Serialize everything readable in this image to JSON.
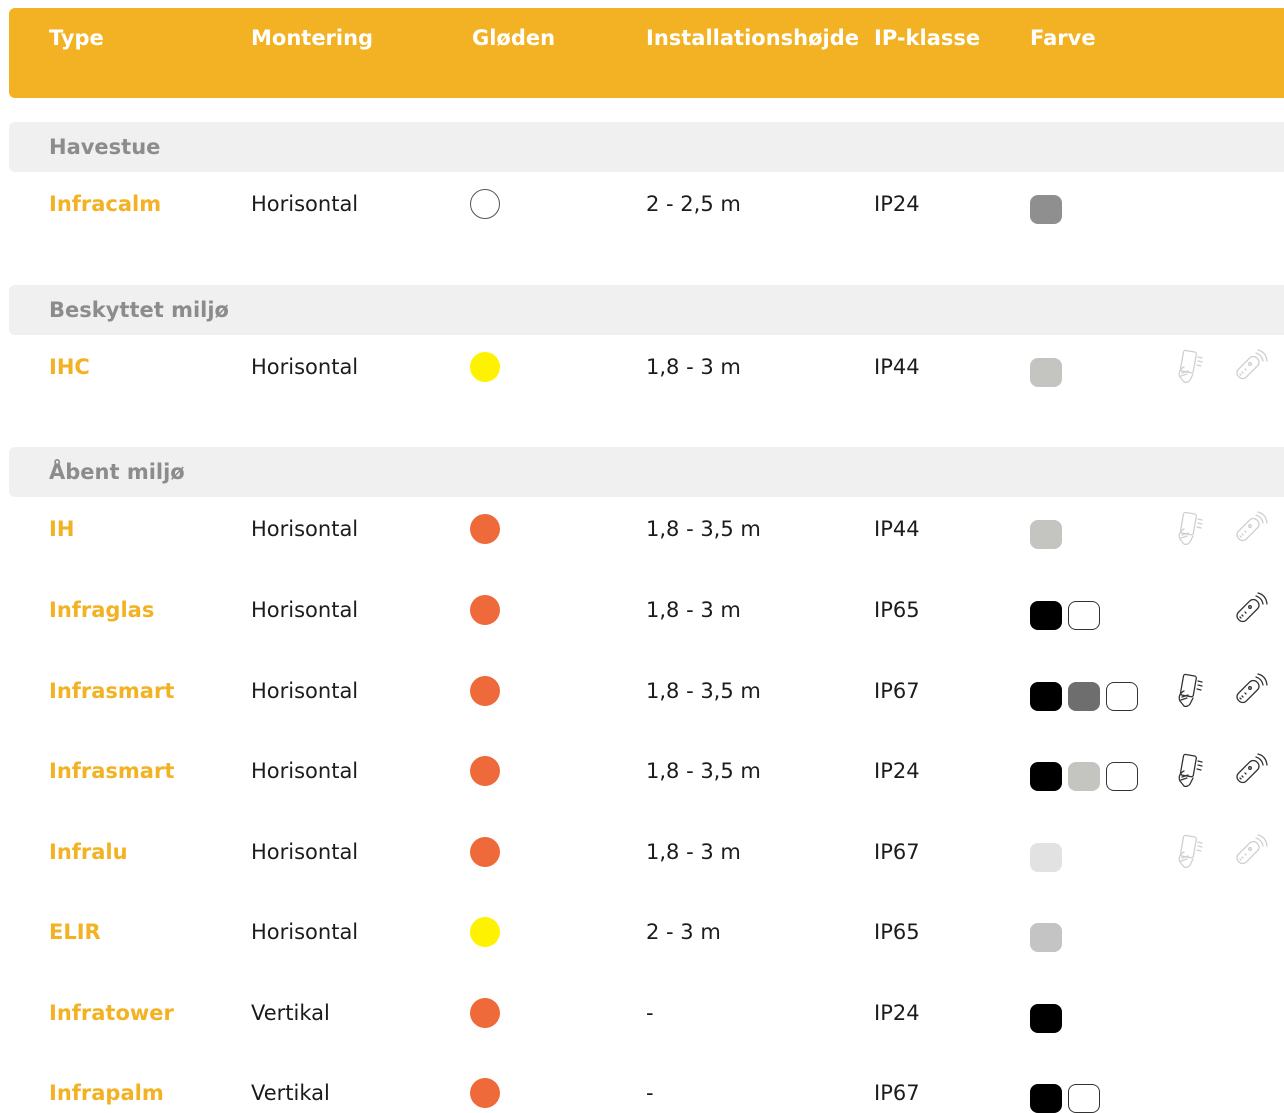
{
  "header": {
    "type": "Type",
    "mount": "Montering",
    "glow": "Gløden",
    "install": "Installationshøjde",
    "ip": "IP-klasse",
    "color": "Farve"
  },
  "colors": {
    "accent": "#f2b224",
    "glow_none": "#ffffff",
    "glow_yellow": "#fff200",
    "glow_orange": "#ef6a3a"
  },
  "groups": [
    {
      "label": "Havestue",
      "products": [
        {
          "type": "Infracalm",
          "mount": "Horisontal",
          "glow": "none",
          "install": "2 - 2,5 m",
          "ip": "IP24",
          "colors": [
            "#8f8f8f"
          ],
          "app_icon": "none",
          "remote_icon": "none"
        }
      ]
    },
    {
      "label": "Beskyttet miljø",
      "products": [
        {
          "type": "IHC",
          "mount": "Horisontal",
          "glow": "yellow",
          "install": "1,8 - 3 m",
          "ip": "IP44",
          "colors": [
            "#c4c4c0"
          ],
          "app_icon": "faded",
          "remote_icon": "faded"
        }
      ]
    },
    {
      "label": "Åbent miljø",
      "products": [
        {
          "type": "IH",
          "mount": "Horisontal",
          "glow": "orange",
          "install": "1,8 - 3,5 m",
          "ip": "IP44",
          "colors": [
            "#c4c4c0"
          ],
          "app_icon": "faded",
          "remote_icon": "faded"
        },
        {
          "type": "Infraglas",
          "mount": "Horisontal",
          "glow": "orange",
          "install": "1,8 - 3 m",
          "ip": "IP65",
          "colors": [
            "#000000",
            "#ffffff"
          ],
          "app_icon": "none",
          "remote_icon": "active"
        },
        {
          "type": "Infrasmart",
          "mount": "Horisontal",
          "glow": "orange",
          "install": "1,8 - 3,5 m",
          "ip": "IP67",
          "colors": [
            "#000000",
            "#6e6e6e",
            "#ffffff"
          ],
          "app_icon": "active",
          "remote_icon": "active"
        },
        {
          "type": "Infrasmart",
          "mount": "Horisontal",
          "glow": "orange",
          "install": "1,8 - 3,5 m",
          "ip": "IP24",
          "colors": [
            "#000000",
            "#c4c4c0",
            "#ffffff"
          ],
          "app_icon": "active",
          "remote_icon": "active"
        },
        {
          "type": "Infralu",
          "mount": "Horisontal",
          "glow": "orange",
          "install": "1,8 - 3 m",
          "ip": "IP67",
          "colors": [
            "#e2e2e2"
          ],
          "app_icon": "faded",
          "remote_icon": "faded"
        },
        {
          "type": "ELIR",
          "mount": "Horisontal",
          "glow": "yellow",
          "install": "2 - 3 m",
          "ip": "IP65",
          "colors": [
            "#c4c4c4"
          ],
          "app_icon": "none",
          "remote_icon": "none"
        },
        {
          "type": "Infratower",
          "mount": "Vertikal",
          "glow": "orange",
          "install": "-",
          "ip": "IP24",
          "colors": [
            "#000000"
          ],
          "app_icon": "none",
          "remote_icon": "none"
        },
        {
          "type": "Infrapalm",
          "mount": "Vertikal",
          "glow": "orange",
          "install": "-",
          "ip": "IP67",
          "colors": [
            "#000000",
            "#ffffff"
          ],
          "app_icon": "none",
          "remote_icon": "none"
        }
      ]
    }
  ]
}
